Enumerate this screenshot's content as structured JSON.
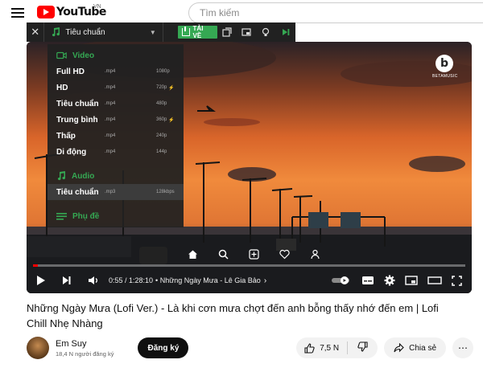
{
  "header": {
    "logo_text": "YouTube",
    "region": "VN",
    "search_placeholder": "Tìm kiếm"
  },
  "extension": {
    "close": "✕",
    "quality_label": "Tiêu chuẩn",
    "download_label": "TẢI VỀ",
    "accent_color": "#35a853"
  },
  "dropdown": {
    "sections": [
      {
        "title": "Video",
        "items": [
          {
            "quality": "Full HD",
            "ext": ".mp4",
            "res": "1080p",
            "hd": ""
          },
          {
            "quality": "HD",
            "ext": ".mp4",
            "res": "720p",
            "hd": "⚡"
          },
          {
            "quality": "Tiêu chuẩn",
            "ext": ".mp4",
            "res": "480p",
            "hd": ""
          },
          {
            "quality": "Trung bình",
            "ext": ".mp4",
            "res": "360p",
            "hd": "⚡"
          },
          {
            "quality": "Thấp",
            "ext": ".mp4",
            "res": "240p",
            "hd": ""
          },
          {
            "quality": "Di động",
            "ext": ".mp4",
            "res": "144p",
            "hd": ""
          }
        ]
      },
      {
        "title": "Audio",
        "items": [
          {
            "quality": "Tiêu chuẩn",
            "ext": ".mp3",
            "res": "128kbps",
            "hd": ""
          }
        ]
      },
      {
        "title": "Phụ đề",
        "items": []
      }
    ]
  },
  "player": {
    "watermark": "BETAMUSIC",
    "watermark_letter": "b",
    "time": "0:55 / 1:28:10",
    "chapter": "• Những Ngày Mưa - Lê Gia Bảo",
    "progress": 0.011
  },
  "video": {
    "title": "Những Ngày Mưa (Lofi Ver.) - Là khi cơn mưa chợt đến anh bỗng thấy nhớ đến em | Lofi Chill Nhẹ Nhàng",
    "channel": "Em Suy",
    "subscribers": "18,4 N người đăng ký",
    "subscribe_label": "Đăng ký",
    "likes": "7,5 N",
    "share_label": "Chia sẻ",
    "more": "⋯"
  }
}
